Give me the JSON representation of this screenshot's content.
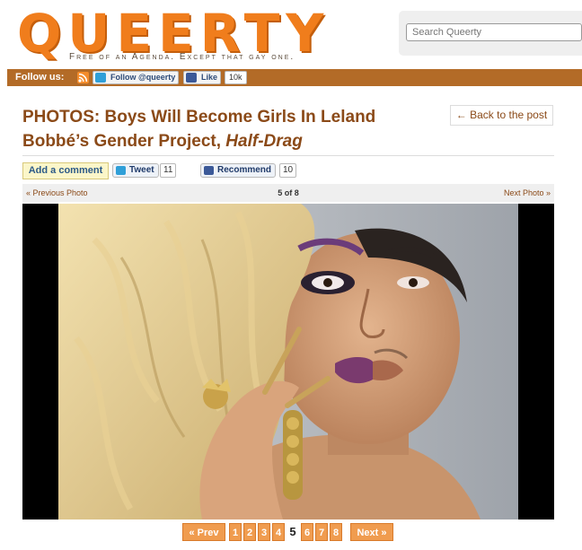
{
  "site": {
    "logo_text": "QUEERTY",
    "tagline": "Free of an Agenda. Except that gay one."
  },
  "search": {
    "placeholder": "Search Queerty"
  },
  "follow_bar": {
    "label": "Follow us:",
    "twitter_label": "Follow @queerty",
    "facebook_label": "Like",
    "facebook_count": "10k"
  },
  "article": {
    "title_main": "PHOTOS: Boys Will Become Girls In Leland Bobbé’s Gender Project, ",
    "title_em": "Half-Drag",
    "back_label": "← Back to the post"
  },
  "share": {
    "add_comment": "Add a comment",
    "tweet_label": "Tweet",
    "tweet_count": "11",
    "recommend_label": "Recommend",
    "recommend_count": "10"
  },
  "photo_nav": {
    "prev": "« Previous Photo",
    "counter": "5 of 8",
    "next": "Next Photo »"
  },
  "pagination": {
    "prev": "« Prev",
    "pages": [
      "1",
      "2",
      "3",
      "4",
      "5",
      "6",
      "7",
      "8"
    ],
    "current": "5",
    "next": "Next »"
  },
  "colors": {
    "brand_orange": "#f07d1c",
    "title_brown": "#8b4a18",
    "bar_brown": "#b36b27"
  }
}
